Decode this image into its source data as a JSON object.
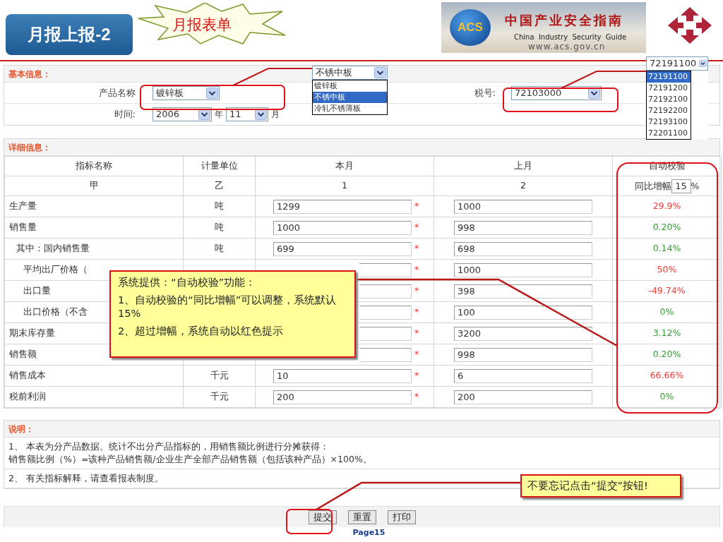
{
  "slide": {
    "title": "月报上报-2",
    "burst_label": "月报表单",
    "page_label": "Page15"
  },
  "banner": {
    "badge": "ACS",
    "title_cn": "中国产业安全指南",
    "title_en": "China  Industry  Security  Guide",
    "url": "www.acs.gov.cn"
  },
  "basic_info": {
    "heading": "基本信息：",
    "product_label": "产品名称",
    "product_value": "镀锌板",
    "tax_label": "税号:",
    "tax_value": "72103000",
    "time_label": "时间:",
    "year_value": "2006",
    "year_unit": "年",
    "month_value": "11",
    "month_unit": "月"
  },
  "product_dropdown": {
    "value": "不锈中板",
    "options": [
      {
        "label": "镀锌板",
        "selected": false
      },
      {
        "label": "不锈中板",
        "selected": true
      },
      {
        "label": "冷轧不锈薄板",
        "selected": false
      }
    ]
  },
  "tax_dropdown": {
    "value": "72191100",
    "options": [
      {
        "label": "72191100",
        "selected": true
      },
      {
        "label": "72191200",
        "selected": false
      },
      {
        "label": "72192100",
        "selected": false
      },
      {
        "label": "72192200",
        "selected": false
      },
      {
        "label": "72193100",
        "selected": false
      },
      {
        "label": "72201100",
        "selected": false
      }
    ]
  },
  "detail": {
    "heading": "详细信息：",
    "columns": [
      "指标名称",
      "计量单位",
      "本月",
      "上月",
      "自动校验"
    ],
    "index_row": [
      "甲",
      "乙",
      "1",
      "2"
    ],
    "growth_label": "同比增幅",
    "growth_value": "15",
    "growth_unit": "%",
    "rows": [
      {
        "name": "生产量",
        "unit": "吨",
        "current": "1299",
        "mark": "*",
        "previous": "1000",
        "check": "29.9%",
        "exceeded": true
      },
      {
        "name": "销售量",
        "unit": "吨",
        "current": "1000",
        "mark": "*",
        "previous": "998",
        "check": "0.20%",
        "exceeded": false,
        "children": [
          {
            "name": "其中：国内销售量",
            "unit": "吨",
            "current": "699",
            "mark": "*",
            "previous": "698",
            "check": "0.14%",
            "exceeded": false,
            "children": [
              {
                "name": "平均出厂价格（",
                "mark": "*",
                "previous": "1000",
                "check": "50%",
                "exceeded": true
              },
              {
                "name": "出口量",
                "mark": "*",
                "previous": "398",
                "check": "-49.74%",
                "exceeded": true
              },
              {
                "name": "出口价格（不含",
                "mark": "*",
                "previous": "100",
                "check": "0%",
                "exceeded": false
              }
            ]
          }
        ]
      },
      {
        "name": "期末库存量",
        "mark": "*",
        "previous": "3200",
        "check": "3.12%",
        "exceeded": false
      },
      {
        "name": "销售额",
        "mark": "*",
        "previous": "998",
        "check": "0.20%",
        "exceeded": false
      },
      {
        "name": "销售成本",
        "unit": "千元",
        "current": "10",
        "mark": "*",
        "previous": "6",
        "check": "66.66%",
        "exceeded": true
      },
      {
        "name": "税前利润",
        "unit": "千元",
        "current": "200",
        "mark": "*",
        "previous": "200",
        "check": "0%",
        "exceeded": false
      }
    ]
  },
  "notes": {
    "heading": "说明：",
    "items": [
      {
        "lines": [
          "1、 本表为分产品数据。统计不出分产品指标的，用销售额比例进行分摊获得：",
          "销售额比例（%）=该种产品销售额/企业生产全部产品销售额（包括该种产品）×100%。"
        ]
      },
      {
        "lines": [
          "2、 有关指标解释，请查看报表制度。"
        ]
      }
    ]
  },
  "buttons": [
    "提交",
    "重置",
    "打印"
  ],
  "callouts": [
    {
      "lines": [
        "系统提供：“自动校验”功能：",
        "1、自动校验的“同比增幅”可以调整，系统默认15%",
        "2、超过增幅，系统自动以红色提示"
      ]
    },
    {
      "lines": [
        "不要忘记点击“提交”按钮!"
      ]
    }
  ]
}
